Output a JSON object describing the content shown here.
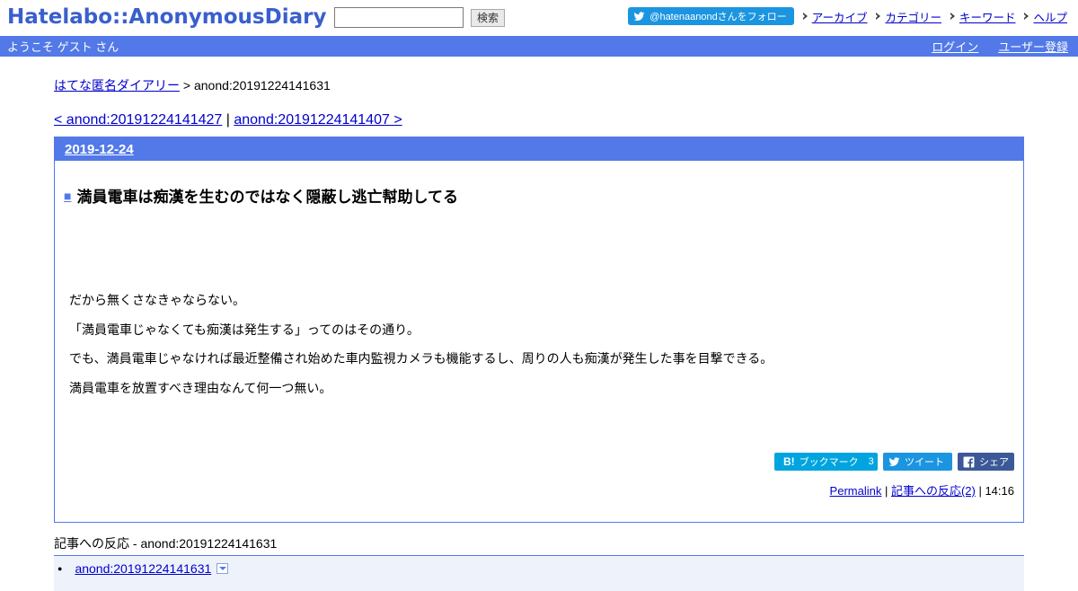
{
  "header": {
    "logo": "Hatelabo::AnonymousDiary",
    "search_button": "検索",
    "search_value": "",
    "follow_button": "@hatenaanondさんをフォロー",
    "nav": [
      "アーカイブ",
      "カテゴリー",
      "キーワード",
      "ヘルプ"
    ]
  },
  "welcome_bar": {
    "greeting": "ようこそ ゲスト さん",
    "login": "ログイン",
    "register": "ユーザー登録"
  },
  "breadcrumb": {
    "home": "はてな匿名ダイアリー",
    "separator": " > ",
    "current": "anond:20191224141631"
  },
  "prevnext": {
    "prev": "< anond:20191224141427",
    "separator": " | ",
    "next": "anond:20191224141407 >"
  },
  "day": {
    "date": "2019-12-24"
  },
  "entry": {
    "marker": "■",
    "title": "満員電車は痴漢を生むのではなく隠蔽し逃亡幇助してる",
    "paragraphs": [
      "だから無くさなきゃならない。",
      "「満員電車じゃなくても痴漢は発生する」ってのはその通り。",
      "でも、満員電車じゃなければ最近整備され始めた車内監視カメラも機能するし、周りの人も痴漢が発生した事を目撃できる。",
      "満員電車を放置すべき理由なんて何一つ無い。"
    ],
    "hatebu_label": "ブックマーク",
    "hatebu_mark": "B!",
    "hatebu_count": "3",
    "tweet_label": "ツイート",
    "share_label": "シェア",
    "permalink": "Permalink",
    "footer_sep": " | ",
    "reactions_link": "記事への反応(2)",
    "time": "14:16"
  },
  "reactions": {
    "title": "記事への反応 - anond:20191224141631",
    "items": [
      "anond:20191224141631"
    ]
  },
  "colors": {
    "accent": "#5279e7",
    "logo": "#3a5fcd",
    "twitter": "#1b95e0",
    "hatebu": "#00a4de",
    "facebook": "#3b5998"
  }
}
